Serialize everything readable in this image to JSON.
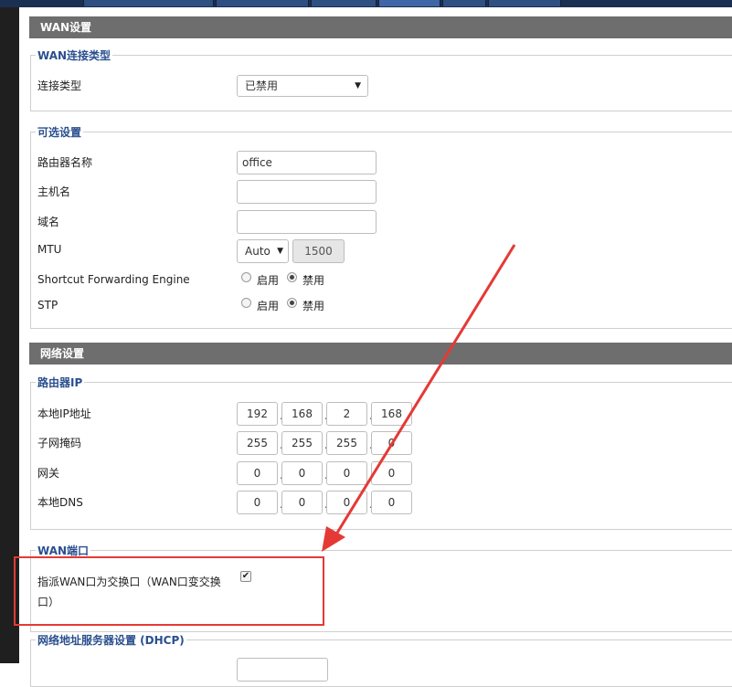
{
  "wan_section": {
    "title": "WAN设置",
    "connection_group": {
      "legend": "WAN连接类型",
      "connection_type_label": "连接类型",
      "connection_type_value": "已禁用"
    },
    "optional_group": {
      "legend": "可选设置",
      "router_name_label": "路由器名称",
      "router_name_value": "office",
      "hostname_label": "主机名",
      "hostname_value": "",
      "domain_label": "域名",
      "domain_value": "",
      "mtu_label": "MTU",
      "mtu_mode": "Auto",
      "mtu_value": "1500",
      "sfe_label": "Shortcut Forwarding Engine",
      "stp_label": "STP",
      "enable_label": "启用",
      "disable_label": "禁用",
      "sfe_selected": "disable",
      "stp_selected": "disable"
    }
  },
  "network_section": {
    "title": "网络设置",
    "router_ip_group": {
      "legend": "路由器IP",
      "local_ip_label": "本地IP地址",
      "local_ip": [
        "192",
        "168",
        "2",
        "168"
      ],
      "subnet_label": "子网掩码",
      "subnet": [
        "255",
        "255",
        "255",
        "0"
      ],
      "gateway_label": "网关",
      "gateway": [
        "0",
        "0",
        "0",
        "0"
      ],
      "dns_label": "本地DNS",
      "dns": [
        "0",
        "0",
        "0",
        "0"
      ]
    },
    "wan_port_group": {
      "legend": "WAN端口",
      "assign_label_line1": "指派WAN口为交换口（WAN口变交换",
      "assign_label_line2": "口）",
      "assign_checked": true
    },
    "dhcp_group": {
      "legend": "网络地址服务器设置 (DHCP)"
    }
  },
  "annotation": {
    "color": "#e53935"
  }
}
